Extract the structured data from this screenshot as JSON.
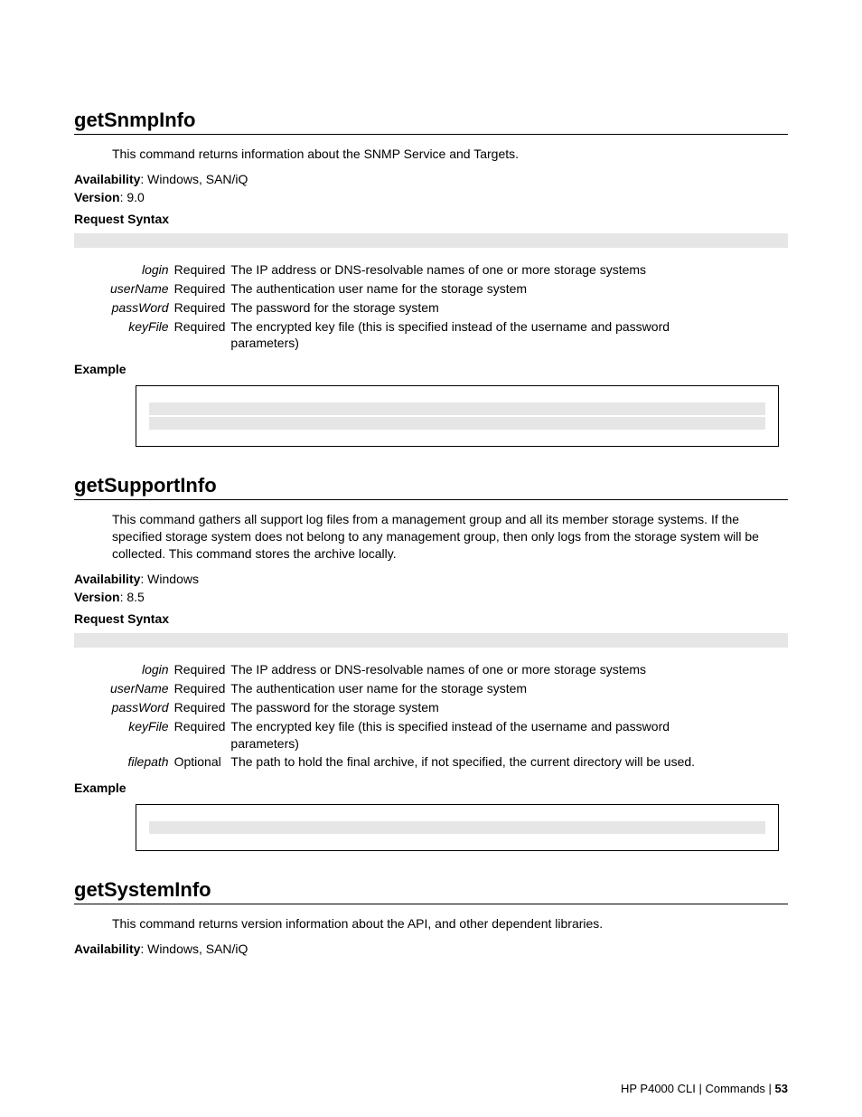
{
  "sections": [
    {
      "title": "getSnmpInfo",
      "desc": "This command returns information about the SNMP Service and Targets.",
      "availability_label": "Availability",
      "availability_value": ": Windows, SAN/iQ",
      "version_label": "Version",
      "version_value": ": 9.0",
      "syntax_label": "Request Syntax",
      "params": [
        {
          "name": "login",
          "req": "Required",
          "desc": "The IP address or DNS-resolvable names of one or more storage systems"
        },
        {
          "name": "userName",
          "req": "Required",
          "desc": "The authentication user name for the storage system"
        },
        {
          "name": "passWord",
          "req": "Required",
          "desc": "The password for the storage system"
        },
        {
          "name": "keyFile",
          "req": "Required",
          "desc": "The encrypted key file (this is specified instead of the username and password parameters)"
        }
      ],
      "example_label": "Example",
      "example_lines": 2
    },
    {
      "title": "getSupportInfo",
      "desc": "This command gathers all support log files from a management group and all its member storage systems. If the specified storage system does not belong to any management group, then only logs from the storage system will be collected. This command stores the archive locally.",
      "availability_label": "Availability",
      "availability_value": ": Windows",
      "version_label": "Version",
      "version_value": ": 8.5",
      "syntax_label": "Request Syntax",
      "params": [
        {
          "name": "login",
          "req": "Required",
          "desc": "The IP address or DNS-resolvable names of one or more storage systems"
        },
        {
          "name": "userName",
          "req": "Required",
          "desc": "The authentication user name for the storage system"
        },
        {
          "name": "passWord",
          "req": "Required",
          "desc": "The password for the storage system"
        },
        {
          "name": "keyFile",
          "req": "Required",
          "desc": "The encrypted key file (this is specified instead of the username and password parameters)"
        },
        {
          "name": "filepath",
          "req": "Optional",
          "desc": "The path to hold the final archive, if not specified, the current directory will be used."
        }
      ],
      "example_label": "Example",
      "example_lines": 1
    },
    {
      "title": "getSystemInfo",
      "desc": "This command returns version information about the API, and other dependent libraries.",
      "availability_label": "Availability",
      "availability_value": ": Windows, SAN/iQ"
    }
  ],
  "footer": {
    "left": "HP P4000 CLI | Commands | ",
    "page": "53"
  }
}
